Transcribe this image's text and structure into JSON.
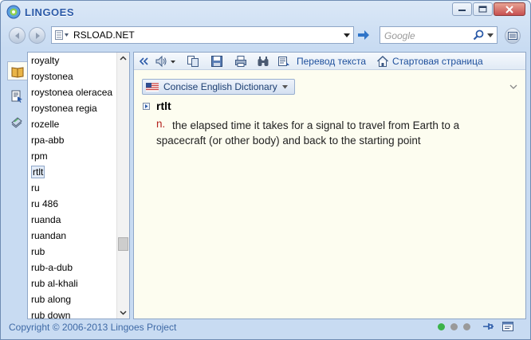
{
  "app": {
    "title": "LINGOES"
  },
  "address": {
    "url": "RSLOAD.NET",
    "search_placeholder": "Google"
  },
  "wordlist": {
    "items": [
      "royalty",
      "roystonea",
      "roystonea oleracea",
      "roystonea regia",
      "rozelle",
      "rpa-abb",
      "rpm",
      "rtlt",
      "ru",
      "ru 486",
      "ruanda",
      "ruandan",
      "rub",
      "rub-a-dub",
      "rub al-khali",
      "rub along",
      "rub down"
    ],
    "selected": "rtlt"
  },
  "toolbar": {
    "translate_label": "Перевод текста",
    "home_label": "Стартовая страница"
  },
  "dictionary": {
    "name": "Concise English Dictionary",
    "entry": {
      "headword": "rtlt",
      "pos": "n.",
      "definition": "the elapsed time it takes for a signal to travel from Earth to a spacecraft (or other body) and back to the starting point"
    }
  },
  "status": {
    "copyright": "Copyright © 2006-2013 Lingoes Project",
    "indicator_colors": [
      "#3bb34a",
      "#9a9a9a",
      "#9a9a9a"
    ]
  },
  "colors": {
    "accent": "#2b5aa8",
    "link": "#1d4f9c",
    "pos": "#b4231e",
    "content_bg": "#fdfdf0"
  }
}
